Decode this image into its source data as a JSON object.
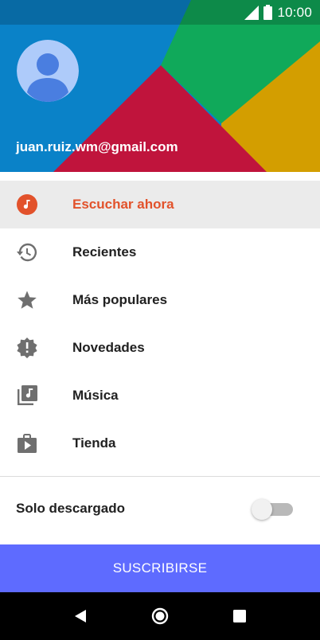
{
  "status_bar": {
    "time": "10:00",
    "icons": [
      "signal-icon",
      "battery-icon"
    ]
  },
  "header": {
    "email": "juan.ruiz.wm@gmail.com",
    "avatar": "account-avatar-icon"
  },
  "menu": {
    "items": [
      {
        "label": "Escuchar ahora",
        "icon": "listen-now-icon",
        "active": true
      },
      {
        "label": "Recientes",
        "icon": "history-icon",
        "active": false
      },
      {
        "label": "Más populares",
        "icon": "star-icon",
        "active": false
      },
      {
        "label": "Novedades",
        "icon": "new-badge-icon",
        "active": false
      },
      {
        "label": "Música",
        "icon": "music-library-icon",
        "active": false
      },
      {
        "label": "Tienda",
        "icon": "store-icon",
        "active": false
      }
    ]
  },
  "downloaded_only": {
    "label": "Solo descargado",
    "enabled": false
  },
  "subscribe_label": "SUSCRIBIRSE",
  "nav": {
    "buttons": [
      "back-icon",
      "home-icon",
      "recents-icon"
    ]
  },
  "colors": {
    "accent": "#e2522b",
    "subscribe": "#5e6bff",
    "header_blue": "#0a82c8",
    "header_red": "#c0143c",
    "header_green": "#10a95a",
    "header_gold": "#d39e00"
  }
}
